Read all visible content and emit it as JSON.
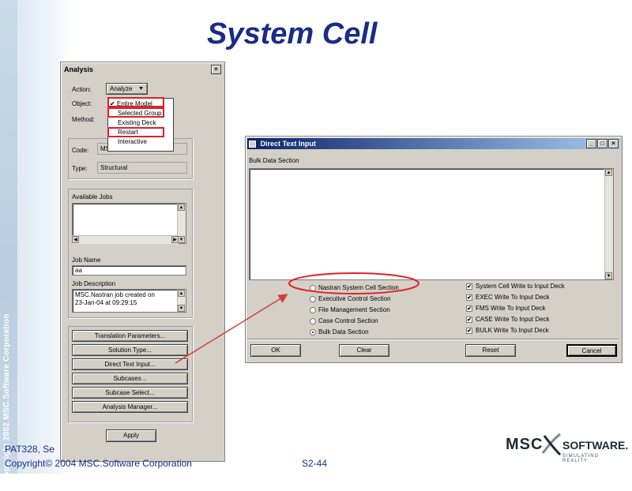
{
  "slide": {
    "title": "System Cell",
    "sidebar_text": "© Copyright 2002 MSC.Software Corporation",
    "footer_line1": "PAT328, Se",
    "footer_line2": "Copyright© 2004 MSC.Software Corporation",
    "page_number": "S2-44",
    "logo": {
      "name": "MSC",
      "suffix": "SOFTWARE.",
      "tagline": "SIMULATING REALITY"
    }
  },
  "analysis": {
    "title": "Analysis",
    "close_glyph": "×",
    "action_label": "Action:",
    "action_value": "Analyze",
    "object_label": "Object:",
    "method_label": "Method:",
    "object_menu": [
      "✔ Entire Model",
      "Selected Group",
      "Existing Deck",
      "Restart",
      "Interactive"
    ],
    "code_label": "Code:",
    "code_value": "MSC.Nastran",
    "type_label": "Type:",
    "type_value": "Structural",
    "available_jobs_label": "Available Jobs",
    "job_name_label": "Job Name",
    "job_name_value": "aa",
    "job_desc_label": "Job Description",
    "job_desc_line1": "MSC.Nastran job created on",
    "job_desc_line2": "23-Jan-04 at 09:29:15",
    "buttons": [
      "Translation Parameters...",
      "Solution Type...",
      "Direct Text Input...",
      "Subcases...",
      "Subcase Select...",
      "Analysis Manager..."
    ],
    "apply_label": "Apply"
  },
  "dti": {
    "title": "Direct Text Input",
    "section_label": "Bulk Data Section",
    "radios": [
      "Nastran System Cell Section",
      "Executive Control Section",
      "File Management Section",
      "Case Control Section",
      "Bulk Data Section"
    ],
    "selected_radio": 4,
    "checks": [
      "System Cell Write to Input Deck",
      "EXEC Write To Input Deck",
      "FMS Write To Input Deck",
      "CASE Write To Input Deck",
      "BULK Write To Input Deck"
    ],
    "ok_label": "OK",
    "clear_label": "Clear",
    "reset_label": "Reset",
    "cancel_label": "Cancel",
    "check_glyph": "✔"
  },
  "colors": {
    "title": "#1a2c86",
    "highlight": "#e0202a",
    "arrow": "#d04040"
  }
}
